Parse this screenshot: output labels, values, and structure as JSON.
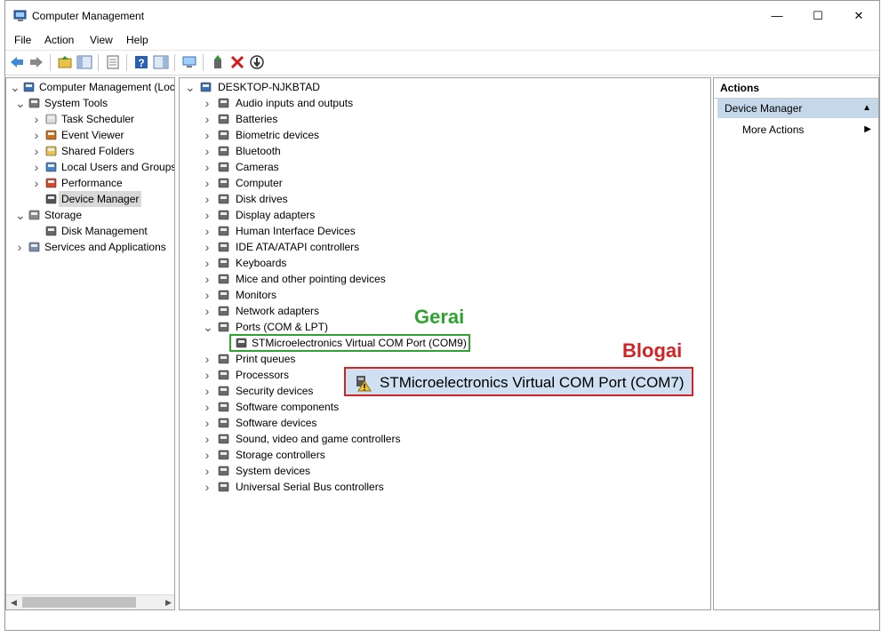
{
  "window": {
    "title": "Computer Management",
    "controls": [
      "—",
      "☐",
      "✕"
    ]
  },
  "menu": [
    "File",
    "Action",
    "View",
    "Help"
  ],
  "left_tree": [
    {
      "label": "Computer Management (Local",
      "icon": "computer-management-icon",
      "expanded": true
    },
    {
      "label": "System Tools",
      "icon": "system-tools-icon",
      "expanded": true
    },
    {
      "label": "Task Scheduler",
      "icon": "clock-icon"
    },
    {
      "label": "Event Viewer",
      "icon": "event-viewer-icon"
    },
    {
      "label": "Shared Folders",
      "icon": "shared-folder-icon"
    },
    {
      "label": "Local Users and Groups",
      "icon": "users-icon"
    },
    {
      "label": "Performance",
      "icon": "performance-icon"
    },
    {
      "label": "Device Manager",
      "icon": "device-manager-icon",
      "selected": true
    },
    {
      "label": "Storage",
      "icon": "storage-icon",
      "expanded": true
    },
    {
      "label": "Disk Management",
      "icon": "disk-management-icon"
    },
    {
      "label": "Services and Applications",
      "icon": "services-icon"
    }
  ],
  "device_tree": {
    "root": "DESKTOP-NJKBTAD",
    "categories": [
      "Audio inputs and outputs",
      "Batteries",
      "Biometric devices",
      "Bluetooth",
      "Cameras",
      "Computer",
      "Disk drives",
      "Display adapters",
      "Human Interface Devices",
      "IDE ATA/ATAPI controllers",
      "Keyboards",
      "Mice and other pointing devices",
      "Monitors",
      "Network adapters",
      "Ports (COM & LPT)",
      "Print queues",
      "Processors",
      "Security devices",
      "Software components",
      "Software devices",
      "Sound, video and game controllers",
      "Storage controllers",
      "System devices",
      "Universal Serial Bus controllers"
    ],
    "port_child": "STMicroelectronics Virtual COM Port (COM9)"
  },
  "annotations": {
    "good_label": "Gerai",
    "bad_label": "Blogai",
    "bad_device": "STMicroelectronics Virtual COM Port (COM7)"
  },
  "actions": {
    "header": "Actions",
    "section": "Device Manager",
    "item": "More Actions"
  },
  "colors": {
    "good": "#2fa32f",
    "bad": "#d12424",
    "section_bg": "#c5d8ea"
  }
}
